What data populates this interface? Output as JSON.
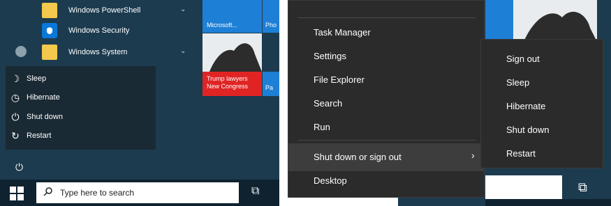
{
  "start_menu": {
    "apps": [
      {
        "label": "Windows PowerShell",
        "icon": "folder-icon"
      },
      {
        "label": "Windows Security",
        "icon": "shield-icon"
      },
      {
        "label": "Windows System",
        "icon": "folder-icon"
      }
    ],
    "power_menu": [
      {
        "label": "Sleep",
        "icon": "sleep-icon"
      },
      {
        "label": "Hibernate",
        "icon": "hibernate-icon"
      },
      {
        "label": "Shut down",
        "icon": "power-icon"
      },
      {
        "label": "Restart",
        "icon": "restart-icon"
      }
    ],
    "tiles": {
      "microsoft": "Microsoft...",
      "ph": "Pho",
      "news": "Trump lawyers\nNew Congress",
      "pa": "Pa"
    }
  },
  "taskbar": {
    "search_placeholder": "Type here to search"
  },
  "context_menu": {
    "items": [
      "Task Manager",
      "Settings",
      "File Explorer",
      "Search",
      "Run",
      "Shut down or sign out",
      "Desktop"
    ],
    "submenu": [
      "Sign out",
      "Sleep",
      "Hibernate",
      "Shut down",
      "Restart"
    ]
  }
}
